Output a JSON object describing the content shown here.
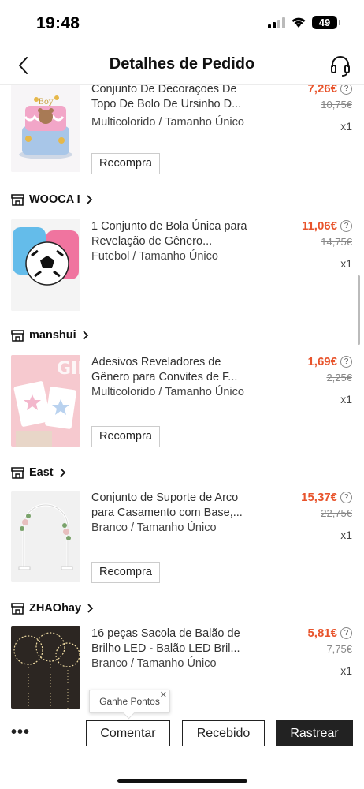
{
  "status_bar": {
    "time": "19:48",
    "battery": "49"
  },
  "header": {
    "title": "Detalhes de Pedido"
  },
  "stores": [
    {
      "name": "WOOCA I"
    },
    {
      "name": "manshui"
    },
    {
      "name": "East"
    },
    {
      "name": "ZHAOhay"
    }
  ],
  "items": [
    {
      "title": "Conjunto De Decorações De Topo De Bolo De Ursinho D...",
      "variant": "Multicolorido / Tamanho Único",
      "price": "7,26€",
      "original_price": "10,75€",
      "quantity": "x1",
      "action": "Recompra"
    },
    {
      "title": "1 Conjunto de Bola Única para Revelação de Gênero...",
      "variant": "Futebol / Tamanho Único",
      "price": "11,06€",
      "original_price": "14,75€",
      "quantity": "x1"
    },
    {
      "title": "Adesivos Reveladores de Gênero para Convites de F...",
      "variant": "Multicolorido / Tamanho Único",
      "price": "1,69€",
      "original_price": "2,25€",
      "quantity": "x1",
      "action": "Recompra"
    },
    {
      "title": "Conjunto de Suporte de Arco para Casamento com Base,...",
      "variant": "Branco / Tamanho Único",
      "price": "15,37€",
      "original_price": "22,75€",
      "quantity": "x1",
      "action": "Recompra"
    },
    {
      "title": "16 peças Sacola de Balão de Brilho LED - Balão LED Bril...",
      "variant": "Branco / Tamanho Único",
      "price": "5,81€",
      "original_price": "7,75€",
      "quantity": "x1"
    }
  ],
  "tooltip": {
    "text": "Ganhe Pontos"
  },
  "bottom_bar": {
    "more": "•••",
    "comment": "Comentar",
    "received": "Recebido",
    "track": "Rastrear"
  },
  "colors": {
    "price": "#e8542c",
    "dark_button": "#222222"
  }
}
